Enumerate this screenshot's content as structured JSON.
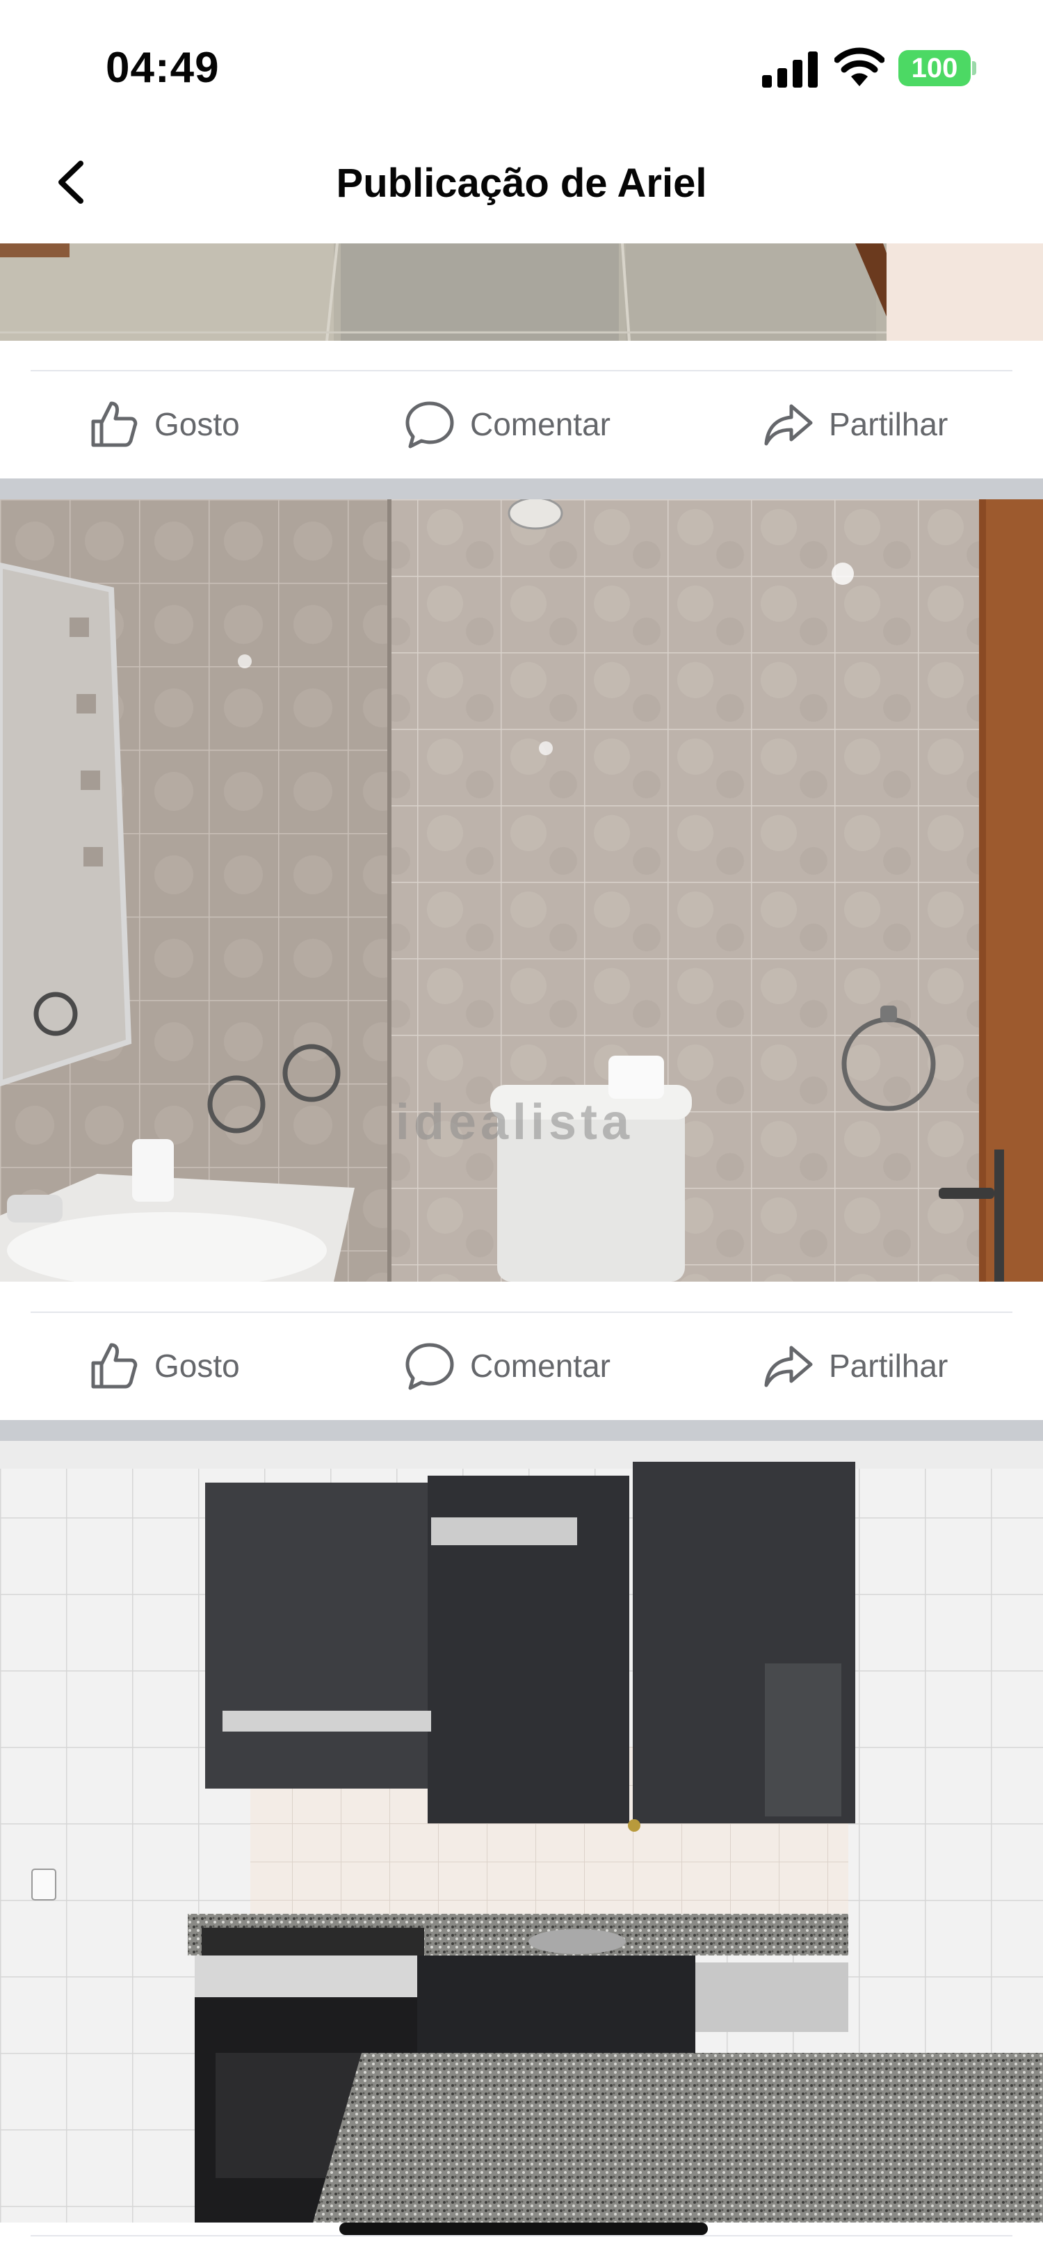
{
  "status_bar": {
    "time": "04:49",
    "battery": "100"
  },
  "header": {
    "title": "Publicação de Ariel"
  },
  "actions": {
    "like": "Gosto",
    "comment": "Comentar",
    "share": "Partilhar"
  },
  "photos": [
    {
      "id": "floor-photo"
    },
    {
      "id": "bathroom-photo",
      "watermark": "idealista"
    },
    {
      "id": "kitchen-photo"
    }
  ],
  "colors": {
    "accent_battery": "#4cd964",
    "text_secondary": "#65676b",
    "divider": "#c9ccd1"
  }
}
